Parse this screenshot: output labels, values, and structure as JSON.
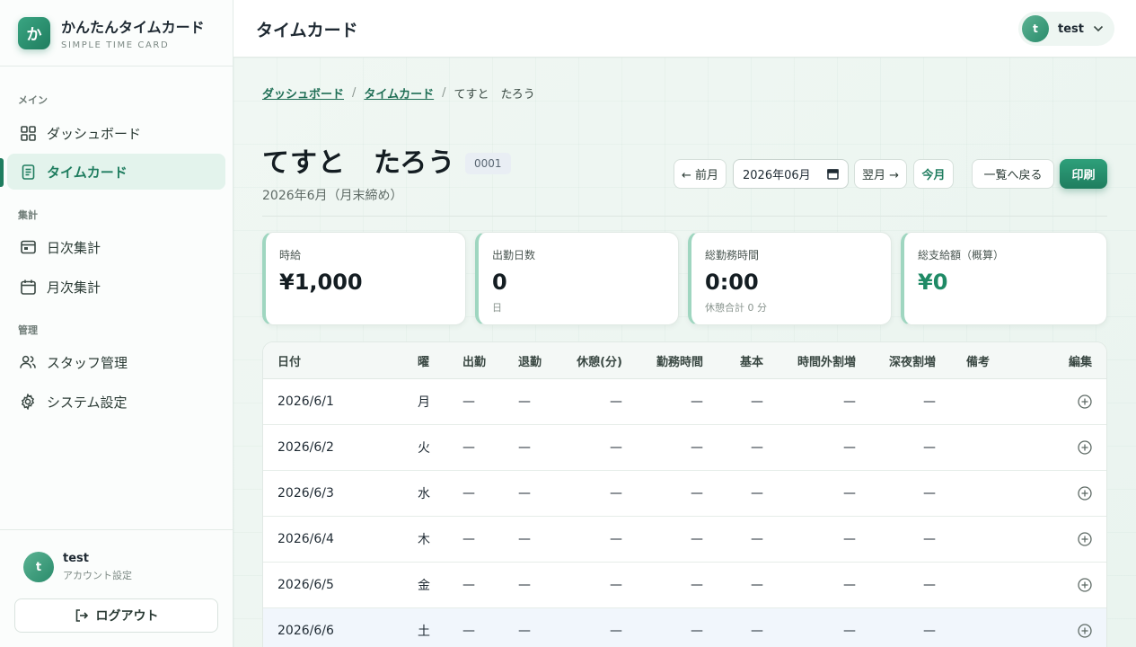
{
  "brand": {
    "logo": "か",
    "title": "かんたんタイムカード",
    "subtitle": "SIMPLE TIME CARD"
  },
  "nav": {
    "sections": [
      "メイン",
      "集計",
      "管理"
    ],
    "items": [
      {
        "label": "ダッシュボード",
        "icon": "grid-icon"
      },
      {
        "label": "タイムカード",
        "icon": "document-icon",
        "active": true
      },
      {
        "label": "日次集計",
        "icon": "daily-calendar-icon"
      },
      {
        "label": "月次集計",
        "icon": "monthly-calendar-icon"
      },
      {
        "label": "スタッフ管理",
        "icon": "users-icon"
      },
      {
        "label": "システム設定",
        "icon": "gear-icon"
      }
    ]
  },
  "footer": {
    "avatar": "t",
    "name": "test",
    "sub": "アカウント設定",
    "logout": "ログアウト"
  },
  "header": {
    "title": "タイムカード",
    "avatar": "t",
    "user": "test"
  },
  "breadcrumb": [
    "ダッシュボード",
    "タイムカード",
    "てすと　たろう"
  ],
  "staff": {
    "name": "てすと　たろう",
    "code": "0001",
    "period": "2026年6月（月末締め）"
  },
  "controls": {
    "prev": "← 前月",
    "month_value": "2026年06月",
    "next": "翌月 →",
    "current": "今月",
    "back": "一覧へ戻る",
    "print": "印刷"
  },
  "cards": [
    {
      "label": "時給",
      "value": "¥1,000",
      "sub": ""
    },
    {
      "label": "出勤日数",
      "value": "0",
      "sub": "日"
    },
    {
      "label": "総勤務時間",
      "value": "0:00",
      "sub": "休憩合計 0 分"
    },
    {
      "label": "総支給額（概算）",
      "value": "¥0",
      "sub": ""
    }
  ],
  "table": {
    "columns": [
      "日付",
      "曜",
      "出勤",
      "退勤",
      "休憩(分)",
      "勤務時間",
      "基本",
      "時間外割増",
      "深夜割増",
      "備考",
      "編集"
    ],
    "rows": [
      {
        "date": "2026/6/1",
        "dow": "月",
        "in": "—",
        "out": "—",
        "brk": "—",
        "work": "—",
        "base": "—",
        "ot": "—",
        "night": "—",
        "note": ""
      },
      {
        "date": "2026/6/2",
        "dow": "火",
        "in": "—",
        "out": "—",
        "brk": "—",
        "work": "—",
        "base": "—",
        "ot": "—",
        "night": "—",
        "note": ""
      },
      {
        "date": "2026/6/3",
        "dow": "水",
        "in": "—",
        "out": "—",
        "brk": "—",
        "work": "—",
        "base": "—",
        "ot": "—",
        "night": "—",
        "note": ""
      },
      {
        "date": "2026/6/4",
        "dow": "木",
        "in": "—",
        "out": "—",
        "brk": "—",
        "work": "—",
        "base": "—",
        "ot": "—",
        "night": "—",
        "note": ""
      },
      {
        "date": "2026/6/5",
        "dow": "金",
        "in": "—",
        "out": "—",
        "brk": "—",
        "work": "—",
        "base": "—",
        "ot": "—",
        "night": "—",
        "note": ""
      },
      {
        "date": "2026/6/6",
        "dow": "土",
        "in": "—",
        "out": "—",
        "brk": "—",
        "work": "—",
        "base": "—",
        "ot": "—",
        "night": "—",
        "note": ""
      }
    ]
  },
  "colors": {
    "accent": "#1f7d5f",
    "active_bg": "#e3f3ec",
    "saturday_bg": "#f1f6fc"
  }
}
